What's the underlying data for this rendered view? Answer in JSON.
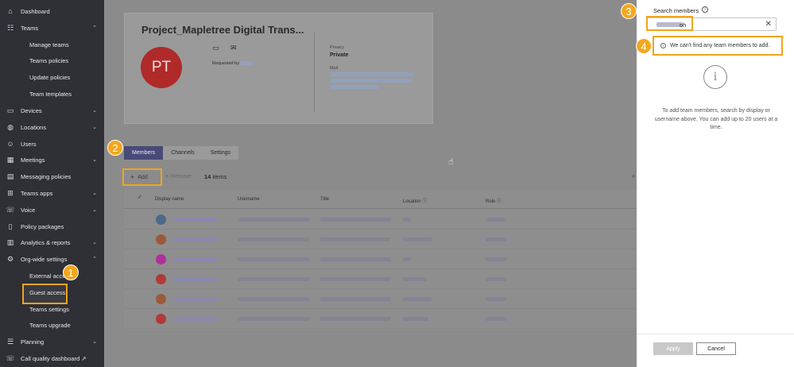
{
  "sidebar": {
    "items": [
      {
        "label": "Dashboard",
        "icon": "home-icon"
      },
      {
        "label": "Teams",
        "icon": "teams-icon",
        "expanded": true
      },
      {
        "label": "Manage teams",
        "sub": true
      },
      {
        "label": "Teams policies",
        "sub": true
      },
      {
        "label": "Update policies",
        "sub": true
      },
      {
        "label": "Team templates",
        "sub": true
      },
      {
        "label": "Devices",
        "icon": "devices-icon"
      },
      {
        "label": "Locations",
        "icon": "globe-icon"
      },
      {
        "label": "Users",
        "icon": "users-icon"
      },
      {
        "label": "Meetings",
        "icon": "meetings-icon"
      },
      {
        "label": "Messaging policies",
        "icon": "message-icon"
      },
      {
        "label": "Teams apps",
        "icon": "apps-icon"
      },
      {
        "label": "Voice",
        "icon": "voice-icon"
      },
      {
        "label": "Policy packages",
        "icon": "policy-icon"
      },
      {
        "label": "Analytics & reports",
        "icon": "analytics-icon"
      },
      {
        "label": "Org-wide settings",
        "icon": "gear-icon",
        "expanded": true
      },
      {
        "label": "External access",
        "sub": true
      },
      {
        "label": "Guest access",
        "sub": true
      },
      {
        "label": "Teams settings",
        "sub": true
      },
      {
        "label": "Teams upgrade",
        "sub": true
      },
      {
        "label": "Planning",
        "icon": "planning-icon"
      },
      {
        "label": "Call quality dashboard",
        "icon": "call-quality-icon"
      }
    ],
    "external_link_glyph": "↗"
  },
  "badges": {
    "b1": "1",
    "b2": "2",
    "b3": "3",
    "b4": "4"
  },
  "team": {
    "title": "Project_Mapletree Digital Trans...",
    "initials": "PT",
    "requested_by": "Requested by",
    "privacy_label": "Privacy",
    "privacy_value": "Private",
    "mail_label": "Mail"
  },
  "tabs": [
    "Members",
    "Channels",
    "Settings"
  ],
  "toolbar": {
    "add": "Add",
    "remove": "Remove",
    "count": "14",
    "items_label": "items"
  },
  "table": {
    "headers": [
      "Display name",
      "Username",
      "Title",
      "Location",
      "Role"
    ],
    "row_count": 6,
    "avatar_colors": [
      "#4a6a8a",
      "#9a5a3a",
      "#b0309a",
      "#b03a3a",
      "#9a5a3a",
      "#b03a3a"
    ]
  },
  "panel": {
    "search_label": "Search members",
    "search_value": "oh",
    "no_results": "We can't find any team members to add.",
    "help_text": "To add team members, search by display or username above. You can add up to 20 users at a time.",
    "apply": "Apply",
    "cancel": "Cancel"
  }
}
